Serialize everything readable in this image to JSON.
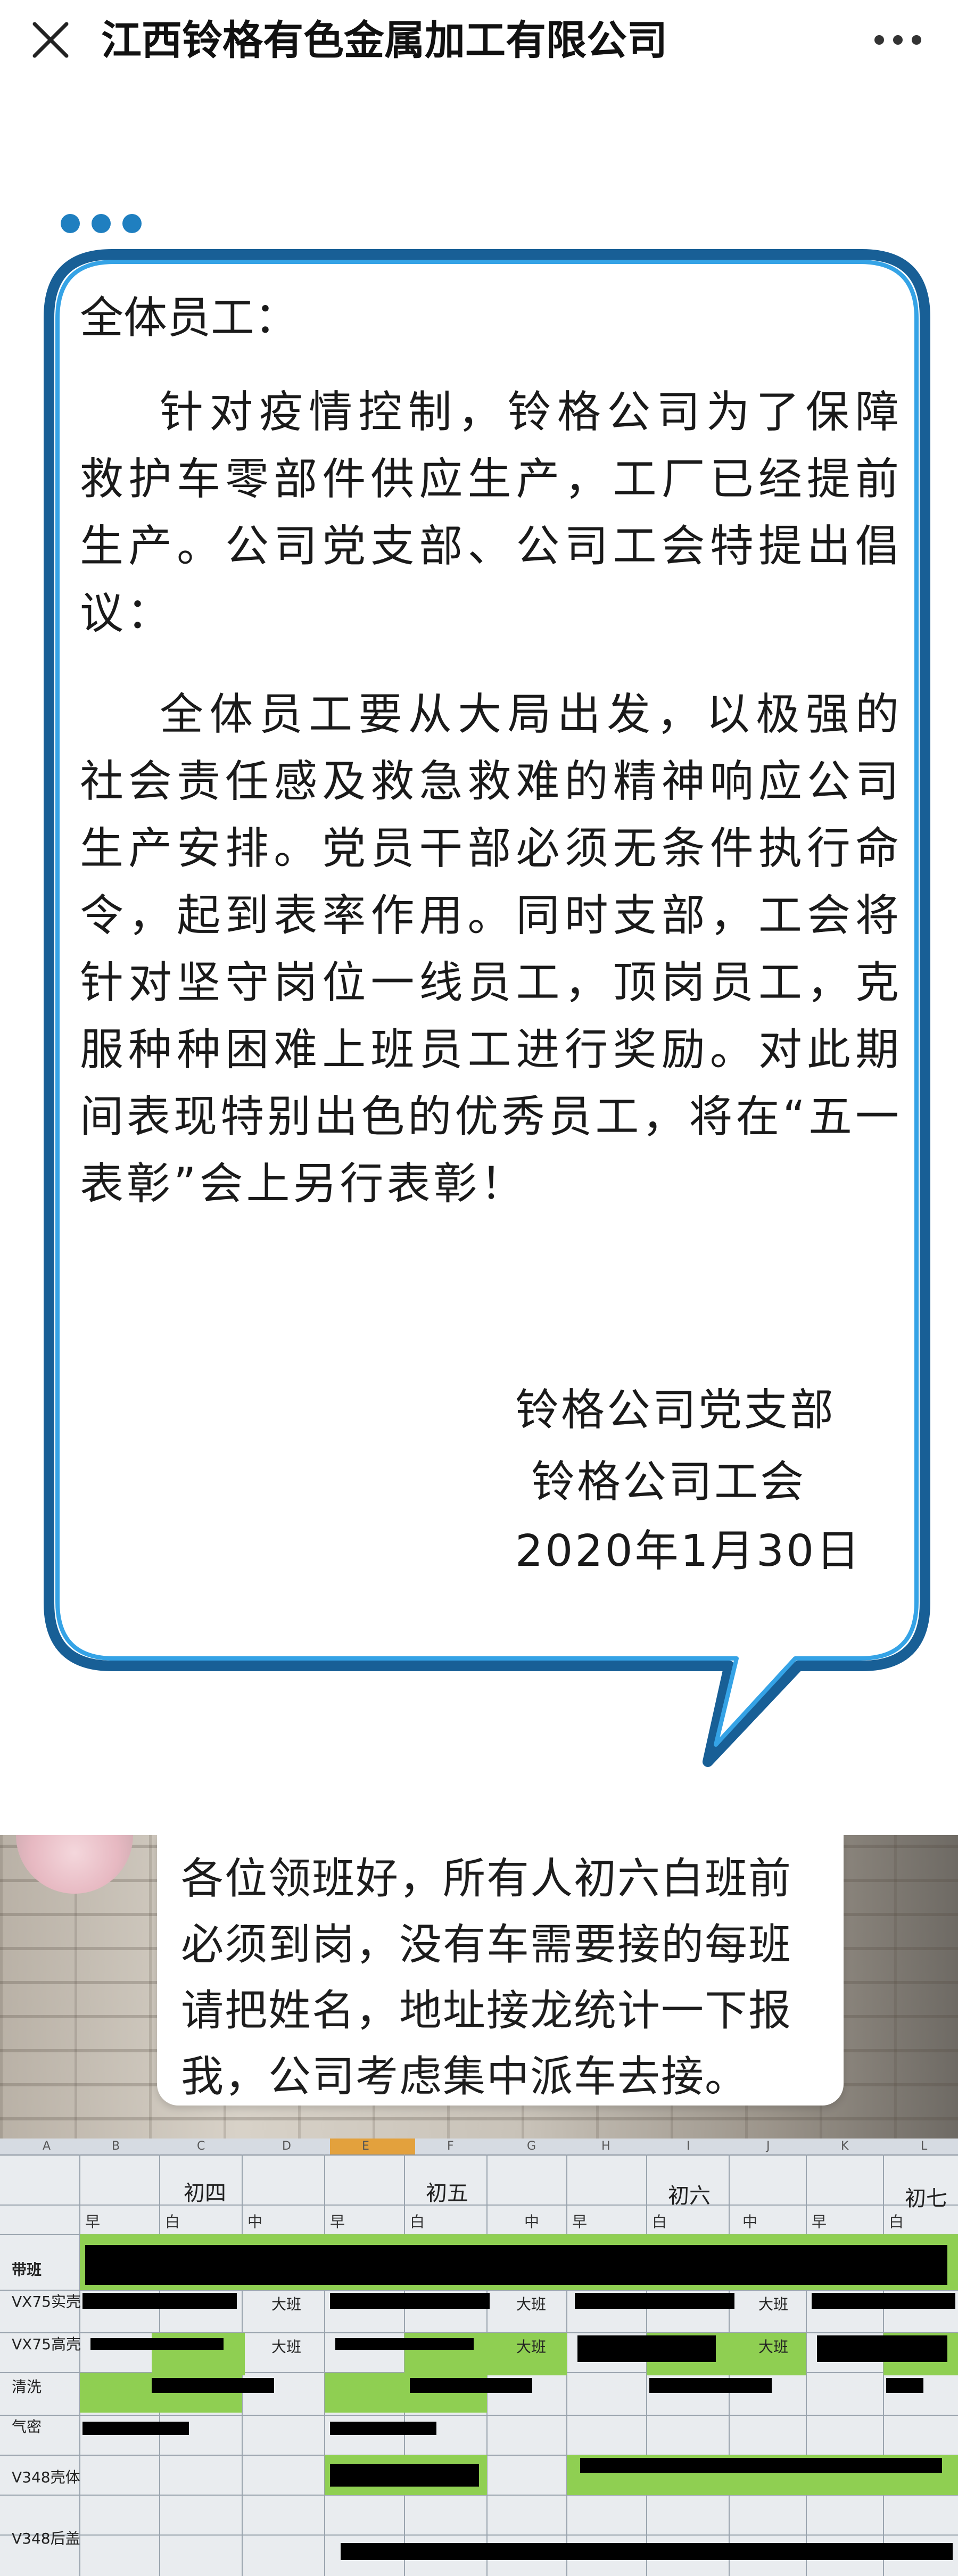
{
  "header": {
    "title": "江西铃格有色金属加工有限公司"
  },
  "letter": {
    "greeting": "全体员工：",
    "paragraph1": "针对疫情控制，铃格公司为了保障救护车零部件供应生产，工厂已经提前生产。公司党支部、公司工会特提出倡议：",
    "paragraph2": "全体员工要从大局出发，以极强的社会责任感及救急救难的精神响应公司生产安排。党员干部必须无条件执行命令，起到表率作用。同时支部，工会将针对坚守岗位一线员工，顶岗员工，克服种种困难上班员工进行奖励。对此期间表现特别出色的优秀员工，将在“五一表彰”会上另行表彰！",
    "signature_line1": "铃格公司党支部",
    "signature_line2": "铃格公司工会",
    "date": "2020年1月30日"
  },
  "photo_message": {
    "text": "各位领班好，所有人初六白班前必须到岗，没有车需要接的每班请把姓名，地址接龙统计一下报我，公司考虑集中派车去接。"
  },
  "spreadsheet": {
    "column_letters": [
      "A",
      "B",
      "C",
      "D",
      "E",
      "F",
      "G",
      "H",
      "I",
      "J",
      "K",
      "L"
    ],
    "days": [
      "初四",
      "初五",
      "初六",
      "初七"
    ],
    "shifts": [
      "早",
      "白",
      "中",
      "早",
      "白",
      "中",
      "早",
      "白",
      "中",
      "早",
      "白"
    ],
    "row_labels": [
      "带班",
      "VX75实壳",
      "VX75高壳",
      "清洗",
      "气密",
      "V348壳体",
      "V348后盖"
    ],
    "cell_notes": [
      "大班",
      "大班",
      "大班",
      "大班",
      "大班",
      "大班"
    ]
  },
  "colors": {
    "bubble_border": "#1f7fc0",
    "sheet_green": "#8fcf52",
    "selected_column": "#e3a13d"
  },
  "icons": [
    "close-icon",
    "more-icon",
    "typing-dots-icon"
  ]
}
